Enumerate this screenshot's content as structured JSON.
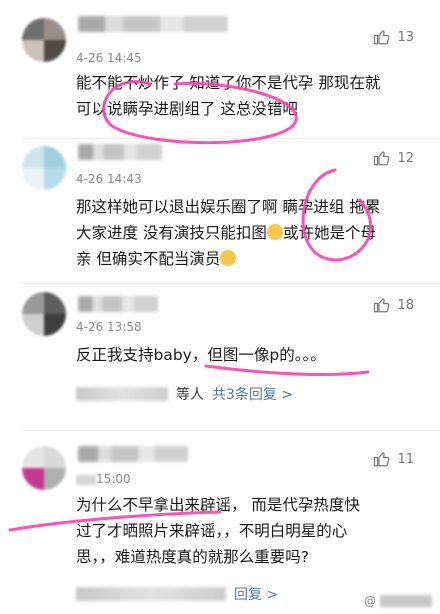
{
  "comments": [
    {
      "time": "4-26 14:45",
      "likes": "13",
      "text_lines": [
        "能不能不炒作了 知道了你不是代孕 那现在就",
        "可以说瞒孕进剧组了 这总没错吧"
      ],
      "avatar_colors": [
        "#6f6f6f",
        "#9a8f86",
        "#c9c2bb",
        "#4f4a45"
      ]
    },
    {
      "time": "4-26 14:43",
      "likes": "12",
      "text_lines": [
        "那这样她可以退出娱乐圈了啊 瞒孕进组 拖累",
        "大家进度 没有演技只能扣图",
        "或许她是个母",
        "亲 但确实不配当演员"
      ],
      "avatar_colors": [
        "#cde7ef",
        "#9fd0df",
        "#e8f4f7",
        "#b6dce7"
      ]
    },
    {
      "time": "4-26 13:58",
      "likes": "18",
      "text_lines": [
        "反正我支持baby，但图一像p的。。。"
      ],
      "reply_suffix": "等人",
      "reply_link": "共3条回复 >",
      "avatar_colors": [
        "#9b9b9b",
        "#5e5e5e",
        "#cfcfcf",
        "#3e3e3e"
      ]
    },
    {
      "time": "15:00",
      "likes": "11",
      "text_lines": [
        "为什么不早拿出来辟谣，  而是代孕热度快",
        "过了才晒照片来辟谣，，不明白明星的心",
        "思，，难道热度真的就那么重要吗?"
      ],
      "reply_link": "回复 >",
      "avatar_colors": [
        "#e6e6e6",
        "#c23a8f",
        "#d9d9d9",
        "#b0b0b0"
      ]
    }
  ],
  "watermark_label": "@"
}
